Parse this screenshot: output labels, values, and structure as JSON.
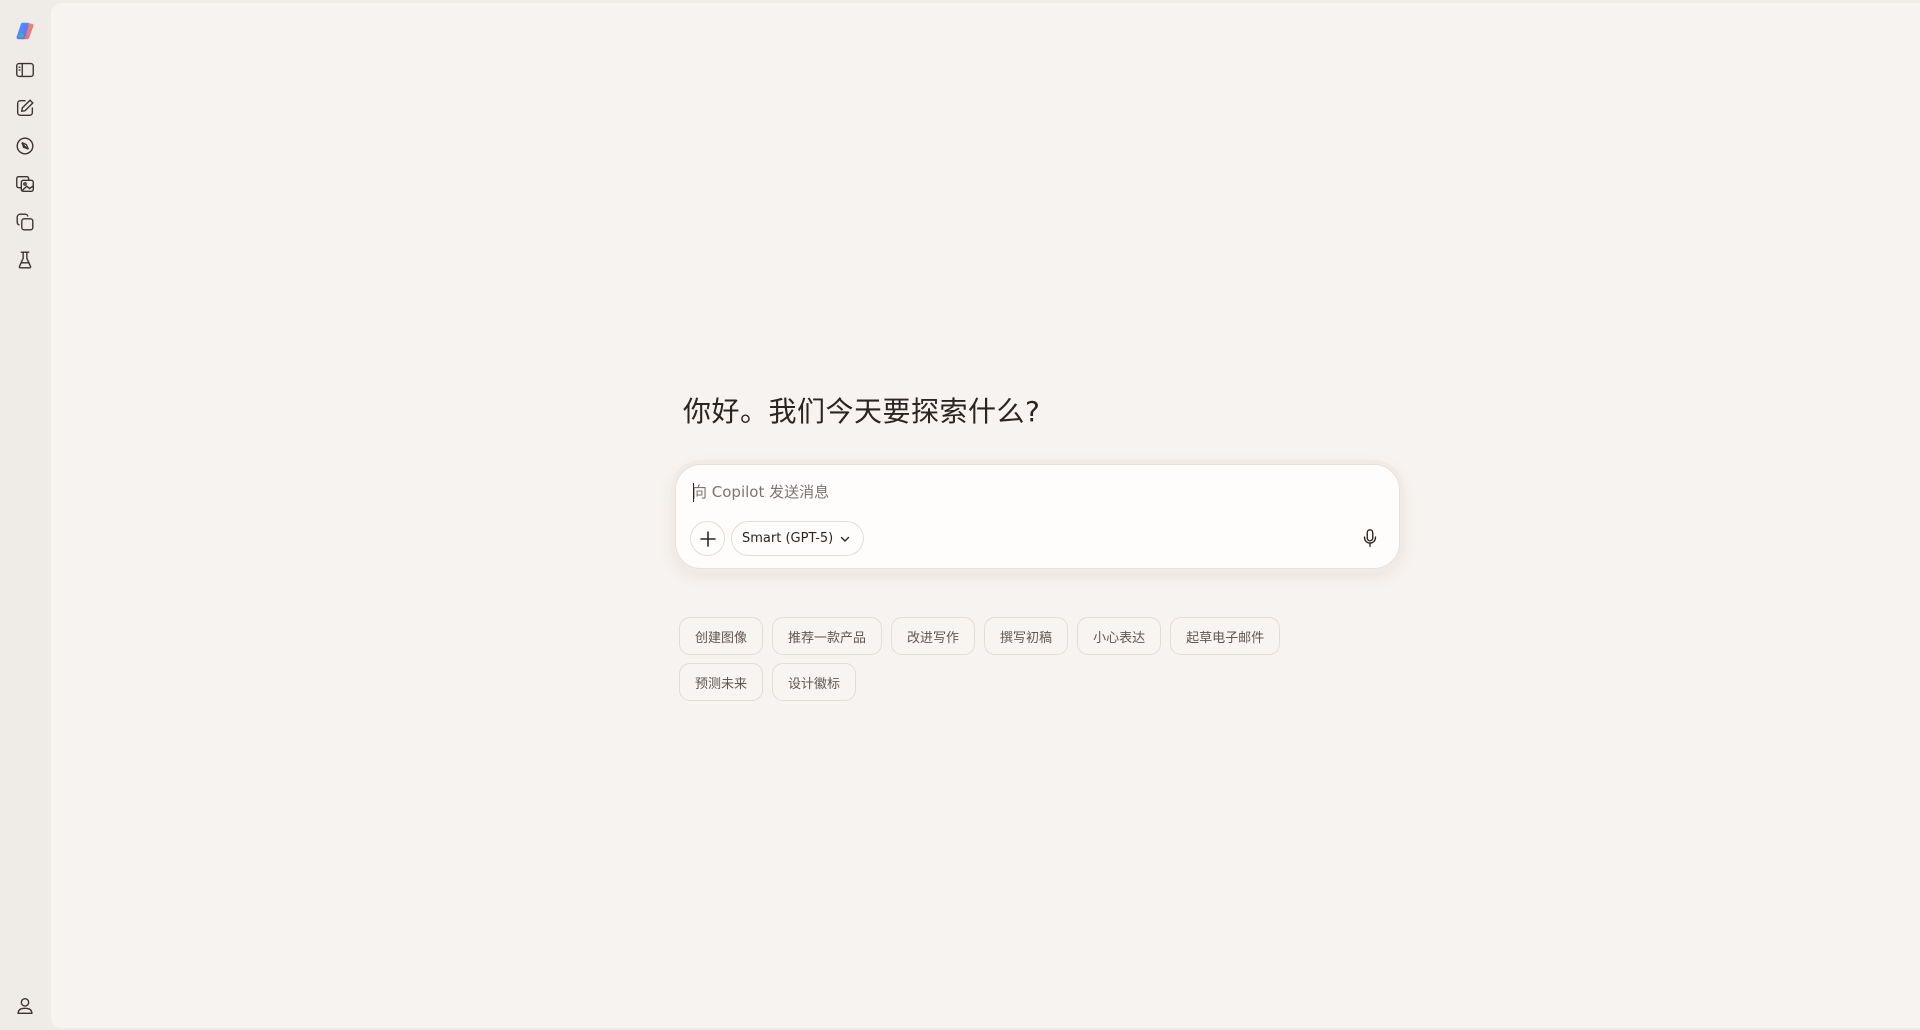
{
  "sidebar": {
    "items": [
      {
        "name": "copilot-logo",
        "icon": "copilot-logo-icon"
      },
      {
        "name": "toggle-sidebar",
        "icon": "sidebar-panel-icon"
      },
      {
        "name": "new-chat",
        "icon": "compose-icon"
      },
      {
        "name": "discover",
        "icon": "compass-icon"
      },
      {
        "name": "library",
        "icon": "image-gallery-icon"
      },
      {
        "name": "pages",
        "icon": "copy-pages-icon"
      },
      {
        "name": "labs",
        "icon": "flask-icon"
      },
      {
        "name": "profile",
        "icon": "person-icon"
      }
    ]
  },
  "main": {
    "greeting": "你好。我们今天要探索什么?",
    "composer": {
      "placeholder": "向 Copilot 发送消息",
      "value": "",
      "add_icon": "plus-icon",
      "model_label": "Smart (GPT-5)",
      "model_icon": "chevron-down-icon",
      "mic_icon": "microphone-icon"
    },
    "suggestions": {
      "row1": [
        "创建图像",
        "推荐一款产品",
        "改进写作",
        "撰写初稿",
        "小心表达",
        "起草电子邮件"
      ],
      "row2": [
        "预测未来",
        "设计徽标"
      ]
    }
  },
  "colors": {
    "rail_background": "#efebe7",
    "main_background": "#f7f3f0",
    "composer_background": "#fffdfc",
    "text_primary": "#2b2522",
    "text_secondary": "#5e5753",
    "logo_colors": [
      "#3aa0ff",
      "#e64fa8",
      "#f2a83b",
      "#2fbf8a"
    ]
  }
}
